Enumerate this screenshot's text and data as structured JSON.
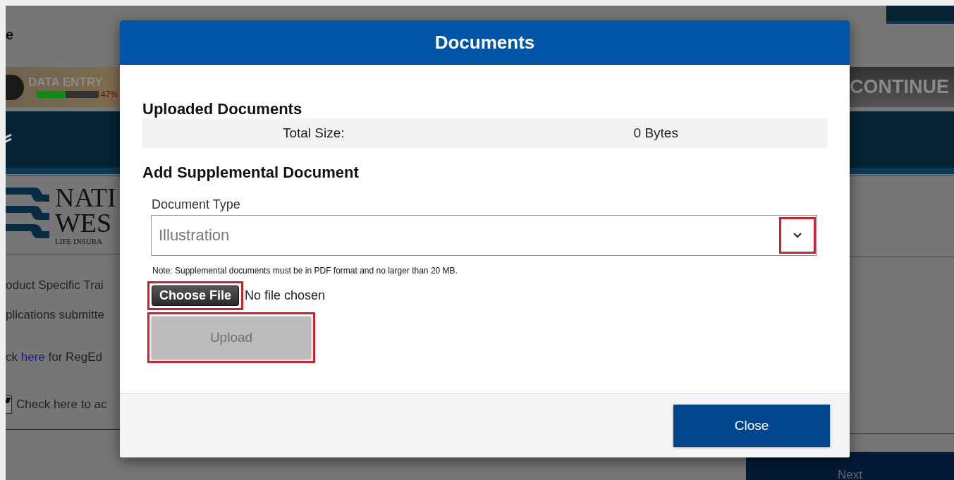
{
  "background_page": {
    "title": "e",
    "progress": {
      "label": "DATA ENTRY",
      "level": 0.47,
      "reading": "47%"
    },
    "logo": {
      "line_1": "NATI",
      "line_2": "WES",
      "line_3": "LIFE INSURA"
    },
    "lines": [
      "oduct Specific Trai",
      "plications submitte"
    ],
    "link_line": {
      "before": "ck",
      "link": "here",
      "after": "for RegEd"
    },
    "checkbox": {
      "label": "Check here to ac",
      "checked": true
    },
    "continue_button": "CONTINUE",
    "next_button": "Next"
  },
  "dialog": {
    "title": "Documents",
    "uploaded": {
      "heading": "Uploaded Documents",
      "label": "Total Size:",
      "value": "0 Bytes"
    },
    "add": {
      "heading": "Add Supplemental Document",
      "field_label": "Document Type",
      "value": "Illustration",
      "dropdown_highlighted": true,
      "note": "Note: Supplemental documents must be in PDF format and no larger than 20 MB.",
      "file_button": {
        "label": "Choose File",
        "highlighted": true
      },
      "file_status": "No file chosen",
      "upload_button": {
        "label": "Upload",
        "disabled": true,
        "highlighted": true
      }
    },
    "close_button": "Close"
  }
}
